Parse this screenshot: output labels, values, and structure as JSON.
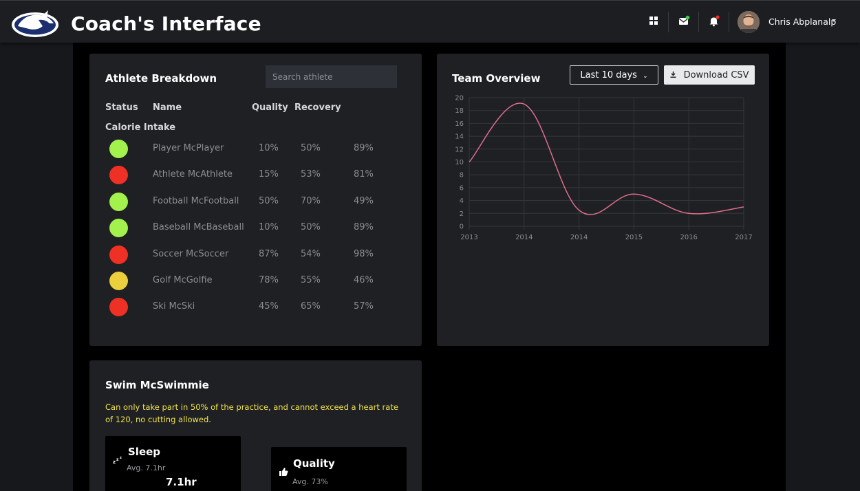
{
  "header": {
    "title": "Coach's Interface",
    "icons": [
      "grid-icon",
      "mail-icon",
      "bell-icon"
    ],
    "user": {
      "name": "Chris Abplanalp"
    }
  },
  "athlete_breakdown": {
    "title": "Athlete Breakdown",
    "search_placeholder": "Search athlete",
    "columns": [
      "Status",
      "Name",
      "Quality",
      "Recovery",
      "Calorie Intake"
    ],
    "rows": [
      {
        "status": "green",
        "name": "Player McPlayer",
        "quality": "10%",
        "recovery": "50%",
        "calorie": "89%"
      },
      {
        "status": "red",
        "name": "Athlete McAthlete",
        "quality": "15%",
        "recovery": "53%",
        "calorie": "81%"
      },
      {
        "status": "green",
        "name": "Football McFootball",
        "quality": "50%",
        "recovery": "70%",
        "calorie": "49%"
      },
      {
        "status": "green",
        "name": "Baseball McBaseball",
        "quality": "10%",
        "recovery": "50%",
        "calorie": "89%"
      },
      {
        "status": "red",
        "name": "Soccer McSoccer",
        "quality": "87%",
        "recovery": "54%",
        "calorie": "98%"
      },
      {
        "status": "yellow",
        "name": "Golf McGolfie",
        "quality": "78%",
        "recovery": "55%",
        "calorie": "46%"
      },
      {
        "status": "red",
        "name": "Ski McSki",
        "quality": "45%",
        "recovery": "65%",
        "calorie": "57%"
      }
    ],
    "status_colors": {
      "green": "#a3f14c",
      "red": "#ee3124",
      "yellow": "#eccf3d"
    }
  },
  "team_overview": {
    "title": "Team Overview",
    "range_label": "Last 10 days",
    "download_label": "Download CSV"
  },
  "chart_data": {
    "type": "line",
    "title": "",
    "xlabel": "",
    "ylabel": "",
    "categories": [
      "2013",
      "2014",
      "2014",
      "2015",
      "2016",
      "2017"
    ],
    "series": [
      {
        "values": [
          10,
          19,
          2.5,
          5,
          2,
          3
        ]
      }
    ],
    "ylim": [
      0,
      20
    ],
    "yticks": [
      0,
      2,
      4,
      6,
      8,
      10,
      12,
      14,
      16,
      18,
      20
    ],
    "grid": true,
    "line_color": "#e36c8c"
  },
  "athlete_detail": {
    "name": "Swim McSwimmie",
    "note": "Can only take part in 50% of the practice, and cannot exceed a heart rate of 120, no cutting allowed.",
    "metrics": [
      {
        "title": "Sleep",
        "avg": "Avg. 7.1hr",
        "value": "7.1hr",
        "icon": "sleep-icon"
      },
      {
        "title": "Quality",
        "avg": "Avg. 73%",
        "value": "",
        "icon": "thumbs-up-icon"
      }
    ]
  }
}
